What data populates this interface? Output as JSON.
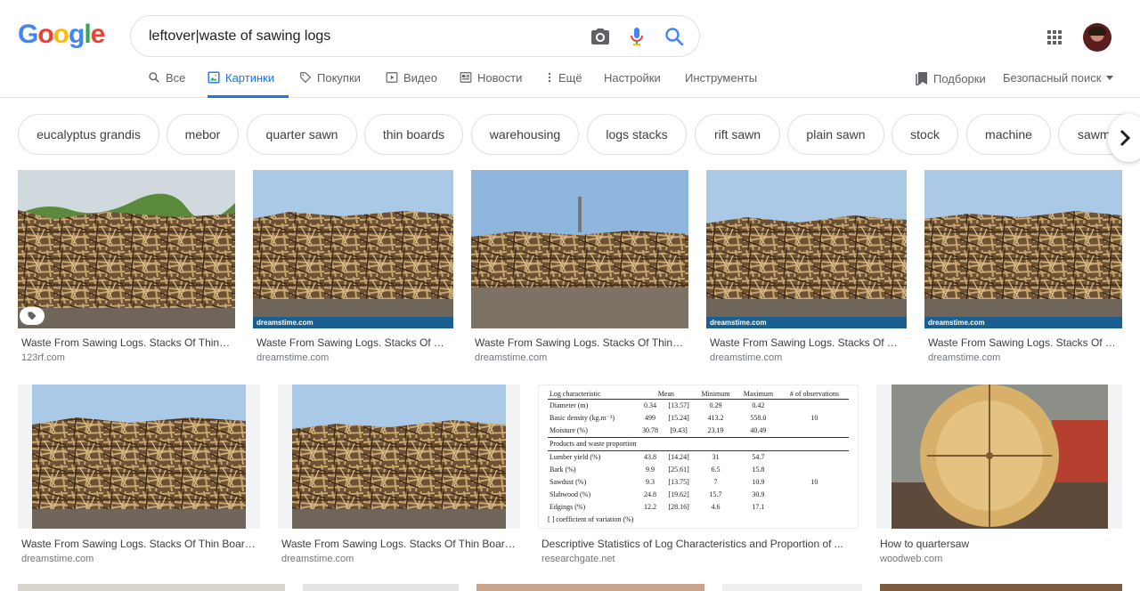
{
  "logo": {
    "text": "Google"
  },
  "search": {
    "value": "leftover|waste of sawing logs"
  },
  "tabs": [
    {
      "label": "Все",
      "icon": "search-icon"
    },
    {
      "label": "Картинки",
      "icon": "images-icon"
    },
    {
      "label": "Покупки",
      "icon": "tag-icon"
    },
    {
      "label": "Видео",
      "icon": "play-icon"
    },
    {
      "label": "Новости",
      "icon": "news-icon"
    },
    {
      "label": "Ещё",
      "icon": "more-vert-icon"
    },
    {
      "label": "Настройки"
    },
    {
      "label": "Инструменты"
    }
  ],
  "tools": {
    "collections": "Подборки",
    "safe_search": "Безопасный поиск"
  },
  "chips": [
    "eucalyptus grandis",
    "mebor",
    "quarter sawn",
    "thin boards",
    "warehousing",
    "logs stacks",
    "rift sawn",
    "plain sawn",
    "stock",
    "machine",
    "sawm"
  ],
  "results": [
    {
      "title": "Waste From Sawing Logs. Stacks Of Thin Boards ...",
      "source": "123rf.com"
    },
    {
      "title": "Waste From Sawing Logs. Stacks Of Thin Boards ...",
      "source": "dreamstime.com"
    },
    {
      "title": "Waste From Sawing Logs. Stacks Of Thin Boards ...",
      "source": "dreamstime.com"
    },
    {
      "title": "Waste From Sawing Logs. Stacks Of Thin Boards ...",
      "source": "dreamstime.com"
    },
    {
      "title": "Waste From Sawing Logs. Stacks Of Thin Boards ...",
      "source": "dreamstime.com"
    },
    {
      "title": "Waste From Sawing Logs. Stacks Of Thin Boards ...",
      "source": "dreamstime.com"
    },
    {
      "title": "Waste From Sawing Logs. Stacks Of Thin Boards ...",
      "source": "dreamstime.com"
    },
    {
      "title": "Descriptive Statistics of Log Characteristics and Proportion of ...",
      "source": "researchgate.net"
    },
    {
      "title": "How to quartersaw",
      "source": "woodweb.com"
    }
  ],
  "watermark": "dreamstime.com",
  "table_image": {
    "headers": [
      "Log characteristic",
      "Mean",
      "Minimum",
      "Maximum",
      "# of observations"
    ],
    "rows": [
      [
        "Diameter (m)",
        "0.34",
        "[13.57]",
        "0.29",
        "0.42",
        ""
      ],
      [
        "Basic density (kg.m⁻³)",
        "499",
        "[15.24]",
        "413.2",
        "558.0",
        "10"
      ],
      [
        "Moisture (%)",
        "30.78",
        "[9.43]",
        "23.19",
        "40.49",
        ""
      ]
    ],
    "section": "Products and waste proportion",
    "rows2": [
      [
        "Lumber yield (%)",
        "43.8",
        "[14.24]",
        "31",
        "54.7",
        ""
      ],
      [
        "Bark (%)",
        "9.9",
        "[25.61]",
        "6.5",
        "15.8",
        ""
      ],
      [
        "Sawdust (%)",
        "9.3",
        "[13.75]",
        "7",
        "10.9",
        "10"
      ],
      [
        "Slabwood (%)",
        "24.8",
        "[19.62]",
        "15.7",
        "30.9",
        ""
      ],
      [
        "Edgings (%)",
        "12.2",
        "[28.16]",
        "4.6",
        "17.1",
        ""
      ]
    ],
    "note": "[ ] coefficient of variation (%)"
  },
  "colors": {
    "accent": "#1a73e8",
    "sky": "#a9c9e6",
    "wood": "#8a6a45"
  }
}
